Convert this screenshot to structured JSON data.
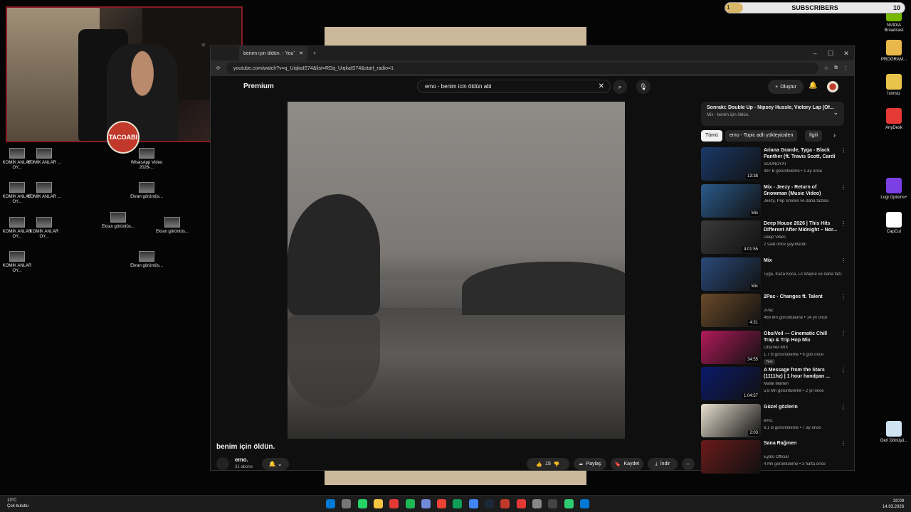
{
  "desktop": {
    "left_icons": [
      {
        "label": "KOMİK ANLAR OY..."
      },
      {
        "label": "KOMİK ANLAR ..."
      },
      {
        "label": "KOMİK ANLAR OY..."
      },
      {
        "label": "KOMİK ANLAR ..."
      },
      {
        "label": "KOMİK ANLAR OY..."
      },
      {
        "label": "KOMİK ANLAR OY..."
      },
      {
        "label": "KOMİK ANLAR OY..."
      }
    ],
    "mid_icons": [
      {
        "label": "WhatsApp Video 2026-..."
      },
      {
        "label": "Ekran görüntüs..."
      },
      {
        "label": "Ekran görüntüs..."
      },
      {
        "label": "Ekran görüntüs..."
      },
      {
        "label": "Ekran görüntüs..."
      }
    ],
    "right_icons": [
      {
        "label": "NVIDIA Broadcast",
        "color": "#76b900"
      },
      {
        "label": "PROGRAM...",
        "color": "#e8b84a"
      },
      {
        "label": "İsimsiz",
        "color": "#e8c44a"
      },
      {
        "label": "AnyDesk",
        "color": "#e53935"
      },
      {
        "label": "Logi Options+",
        "color": "#7b3fe4"
      },
      {
        "label": "CapCut",
        "color": "#ffffff"
      },
      {
        "label": "Geri Dönüşü...",
        "color": "#cfe3f0"
      }
    ]
  },
  "stream": {
    "logo_text": "TACOABI",
    "subscribers_label": "SUBSCRIBERS",
    "subscribers_current": "1",
    "subscribers_goal": "10",
    "subscribers_progress": 0.1
  },
  "browser": {
    "tab_title": "benim için öldün. - YouTube",
    "new_tab": "+",
    "url": "youtube.com/watch?v=q_UiqkaIS74&list=RDq_UiqkaIS74&start_radio=1",
    "min": "–",
    "max": "☐",
    "close": "✕"
  },
  "youtube": {
    "logo": "Premium",
    "search_value": "emo - benim icin öldün abi",
    "create_label": "Oluştur",
    "video_title": "benim için öldün.",
    "channel_name": "emo.",
    "channel_subs": "31 abone",
    "like_count": "15",
    "share_label": "Paylaş",
    "save_label": "Kaydet",
    "download_label": "İndir",
    "next_title": "Sonraki: Double Up - Nipsey Hussle, Victory Lap [Of...",
    "next_sub": "Mix - benim için öldün.",
    "chips": [
      "Tümü",
      "emo - Topic adlı yükleyiciden",
      "İlgili"
    ],
    "items": [
      {
        "title": "Ariana Grande, Tyga - Black Panther (ft. Travis Scott, Cardi ...",
        "channel": "SOUNDYXI",
        "meta": "497 B görüntüleme • 1 ay önce",
        "duration": "13:38",
        "color": "#1a3a6a"
      },
      {
        "title": "Mix - Jeezy - Return of Snowman (Music Video)",
        "channel": "Jeezy, Pop Smoke ve daha fazlası",
        "meta": "",
        "duration": "Mix",
        "color": "#2b5a8a"
      },
      {
        "title": "Deep House 2026 | This Hits Different After Midnight – Nor...",
        "channel": "Deep Vibes",
        "meta": "2 saat önce yayınlandı",
        "duration": "4:01:55",
        "color": "#3a3a3a"
      },
      {
        "title": "Mix",
        "channel": "Tyga, Kaza Koca, Lil Wayne ve daha fazl...",
        "meta": "",
        "duration": "Mix",
        "color": "#2a4a7a"
      },
      {
        "title": "2Pac - Changes ft. Talent",
        "channel": "2Pac",
        "meta": "468 Mn görüntüleme • 14 yıl önce",
        "duration": "4:31",
        "color": "#6a4a2a"
      },
      {
        "title": "ObsiVeil — Cinematic Chill Trap & Trip Hop Mix",
        "channel": "ObsiVeil MIX",
        "meta": "1,7 B görüntüleme • 6 gün önce",
        "duration": "34:55",
        "color": "#b01a5a",
        "badge": "Yeni"
      },
      {
        "title": "A Message from the Stars (1111hz) | 1 hour handpan ...",
        "channel": "Malte Marten",
        "meta": "5,8 Mn görüntüleme • 2 yıl önce",
        "duration": "1:04:57",
        "color": "#0a1a6a"
      },
      {
        "title": "Güzel gözlerin",
        "channel": "emo.",
        "meta": "6,1 B görüntüleme • 7 ay önce",
        "duration": "2:03",
        "color": "#e8e0d0"
      },
      {
        "title": "Sana Rağmen",
        "channel": "Eyplo Official",
        "meta": "4 Mn görüntüleme • 3 hafta önce",
        "duration": "",
        "color": "#6a1a1a"
      }
    ]
  },
  "taskbar": {
    "temp": "13°C",
    "weather": "Çok bulutlu",
    "time": "20:09",
    "date": "14.03.2026"
  }
}
